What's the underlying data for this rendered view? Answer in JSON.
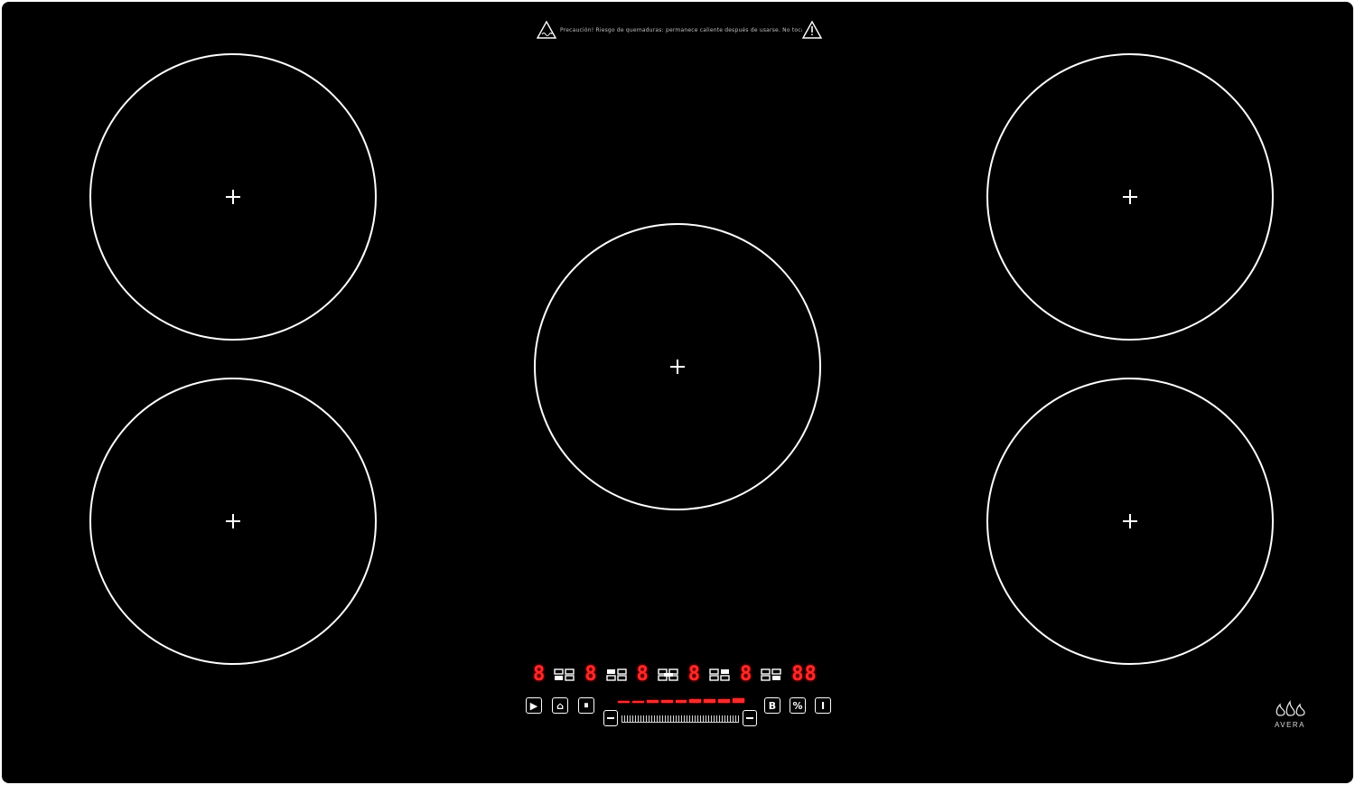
{
  "warning": {
    "text": "Precaución! Riesgo de quemaduras: permanece caliente después de usarse. No tocar la superficie cuando esté caliente."
  },
  "zones": [
    {
      "id": "front-left-top"
    },
    {
      "id": "front-left-bottom"
    },
    {
      "id": "center"
    },
    {
      "id": "right-top"
    },
    {
      "id": "right-bottom"
    }
  ],
  "display": {
    "zone_levels": [
      "8",
      "8",
      "8",
      "8",
      "8"
    ],
    "timer": "88"
  },
  "controls": {
    "power_level_fraction": 1.0,
    "buttons": {
      "play": "▶",
      "lock": "⌂",
      "pause": "⏸",
      "boost": "B",
      "keep_warm": "%",
      "power": "I"
    }
  },
  "brand": {
    "name": "AVERA"
  },
  "colors": {
    "glass": "#000000",
    "lines": "#ffffff",
    "display": "#ff2a2a"
  }
}
